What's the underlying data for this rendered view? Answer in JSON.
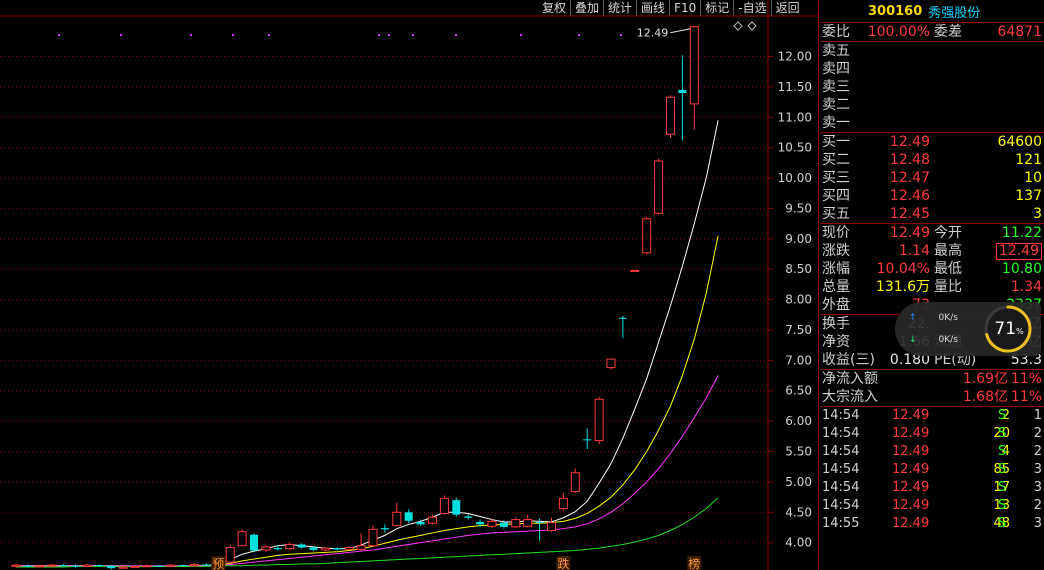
{
  "toolbar": {
    "buttons": [
      "复权",
      "叠加",
      "统计",
      "画线",
      "F10",
      "标记",
      "-自选",
      "返回"
    ]
  },
  "stock": {
    "code": "300160",
    "name": "秀强股份"
  },
  "chart_data": {
    "type": "candlestick",
    "price_ticks": [
      "12.00",
      "11.50",
      "11.00",
      "10.50",
      "10.00",
      "9.50",
      "9.00",
      "8.50",
      "8.00",
      "7.50",
      "7.00",
      "6.50",
      "6.00",
      "5.50",
      "5.00",
      "4.50",
      "4.00"
    ],
    "ylim": [
      3.55,
      12.65
    ],
    "high_label": "12.49",
    "markers": [
      "预",
      "跌",
      "榜"
    ],
    "candles": [
      {
        "o": 3.61,
        "c": 3.63,
        "h": 3.65,
        "l": 3.59
      },
      {
        "o": 3.62,
        "c": 3.61,
        "h": 3.64,
        "l": 3.59
      },
      {
        "o": 3.61,
        "c": 3.62,
        "h": 3.64,
        "l": 3.6
      },
      {
        "o": 3.62,
        "c": 3.63,
        "h": 3.65,
        "l": 3.6
      },
      {
        "o": 3.63,
        "c": 3.62,
        "h": 3.65,
        "l": 3.61
      },
      {
        "o": 3.62,
        "c": 3.61,
        "h": 3.64,
        "l": 3.59
      },
      {
        "o": 3.61,
        "c": 3.63,
        "h": 3.65,
        "l": 3.6
      },
      {
        "o": 3.63,
        "c": 3.62,
        "h": 3.64,
        "l": 3.6
      },
      {
        "o": 3.62,
        "c": 3.58,
        "h": 3.63,
        "l": 3.56
      },
      {
        "o": 3.58,
        "c": 3.6,
        "h": 3.62,
        "l": 3.57
      },
      {
        "o": 3.6,
        "c": 3.61,
        "h": 3.63,
        "l": 3.59
      },
      {
        "o": 3.61,
        "c": 3.62,
        "h": 3.64,
        "l": 3.6
      },
      {
        "o": 3.62,
        "c": 3.61,
        "h": 3.63,
        "l": 3.6
      },
      {
        "o": 3.61,
        "c": 3.63,
        "h": 3.65,
        "l": 3.6
      },
      {
        "o": 3.63,
        "c": 3.62,
        "h": 3.64,
        "l": 3.61
      },
      {
        "o": 3.62,
        "c": 3.64,
        "h": 3.66,
        "l": 3.61
      },
      {
        "o": 3.64,
        "c": 3.63,
        "h": 3.66,
        "l": 3.62
      },
      {
        "o": 3.63,
        "c": 3.67,
        "h": 3.7,
        "l": 3.62
      },
      {
        "o": 3.68,
        "c": 3.92,
        "h": 3.96,
        "l": 3.67
      },
      {
        "o": 3.95,
        "c": 4.18,
        "h": 4.22,
        "l": 3.94
      },
      {
        "o": 4.13,
        "c": 3.87,
        "h": 4.15,
        "l": 3.84
      },
      {
        "o": 3.88,
        "c": 3.93,
        "h": 3.96,
        "l": 3.85
      },
      {
        "o": 3.91,
        "c": 3.89,
        "h": 3.95,
        "l": 3.87
      },
      {
        "o": 3.9,
        "c": 3.97,
        "h": 4.0,
        "l": 3.88
      },
      {
        "o": 3.97,
        "c": 3.92,
        "h": 3.99,
        "l": 3.9
      },
      {
        "o": 3.92,
        "c": 3.88,
        "h": 3.94,
        "l": 3.86
      },
      {
        "o": 3.88,
        "c": 3.91,
        "h": 3.93,
        "l": 3.86
      },
      {
        "o": 3.91,
        "c": 3.89,
        "h": 3.92,
        "l": 3.87
      },
      {
        "o": 3.89,
        "c": 3.92,
        "h": 3.94,
        "l": 3.88
      },
      {
        "o": 3.89,
        "c": 3.95,
        "h": 4.15,
        "l": 3.87
      },
      {
        "o": 3.95,
        "c": 4.22,
        "h": 4.28,
        "l": 3.93
      },
      {
        "o": 4.24,
        "c": 4.22,
        "h": 4.3,
        "l": 4.16
      },
      {
        "o": 4.28,
        "c": 4.5,
        "h": 4.66,
        "l": 4.27
      },
      {
        "o": 4.5,
        "c": 4.36,
        "h": 4.55,
        "l": 4.32
      },
      {
        "o": 4.34,
        "c": 4.3,
        "h": 4.38,
        "l": 4.28
      },
      {
        "o": 4.32,
        "c": 4.42,
        "h": 4.46,
        "l": 4.3
      },
      {
        "o": 4.48,
        "c": 4.73,
        "h": 4.78,
        "l": 4.46
      },
      {
        "o": 4.7,
        "c": 4.46,
        "h": 4.74,
        "l": 4.43
      },
      {
        "o": 4.43,
        "c": 4.41,
        "h": 4.47,
        "l": 4.38
      },
      {
        "o": 4.34,
        "c": 4.3,
        "h": 4.38,
        "l": 4.26
      },
      {
        "o": 4.27,
        "c": 4.35,
        "h": 4.4,
        "l": 4.24
      },
      {
        "o": 4.33,
        "c": 4.26,
        "h": 4.36,
        "l": 4.23
      },
      {
        "o": 4.26,
        "c": 4.38,
        "h": 4.42,
        "l": 4.24
      },
      {
        "o": 4.27,
        "c": 4.38,
        "h": 4.46,
        "l": 4.25
      },
      {
        "o": 4.34,
        "c": 4.33,
        "h": 4.4,
        "l": 4.03
      },
      {
        "o": 4.2,
        "c": 4.33,
        "h": 4.41,
        "l": 4.18
      },
      {
        "o": 4.56,
        "c": 4.73,
        "h": 4.82,
        "l": 4.52
      },
      {
        "o": 4.84,
        "c": 5.15,
        "h": 5.22,
        "l": 4.82
      },
      {
        "o": 5.7,
        "c": 5.69,
        "h": 5.88,
        "l": 5.54
      },
      {
        "o": 5.68,
        "c": 6.36,
        "h": 6.4,
        "l": 5.62
      },
      {
        "o": 6.88,
        "c": 7.02,
        "h": 7.03,
        "l": 6.85
      },
      {
        "o": 7.7,
        "c": 7.69,
        "h": 7.73,
        "l": 7.37
      },
      {
        "o": 8.47,
        "c": 8.48,
        "h": 8.49,
        "l": 8.46
      },
      {
        "o": 8.77,
        "c": 9.33,
        "h": 9.36,
        "l": 8.74
      },
      {
        "o": 9.42,
        "c": 10.28,
        "h": 10.32,
        "l": 9.4
      },
      {
        "o": 10.72,
        "c": 11.33,
        "h": 11.36,
        "l": 10.66
      },
      {
        "o": 11.45,
        "c": 11.4,
        "h": 12.02,
        "l": 10.62
      },
      {
        "o": 11.22,
        "c": 12.49,
        "h": 12.49,
        "l": 10.8
      }
    ],
    "ma": [
      {
        "color": "#ffffff",
        "values": [
          3.62,
          3.62,
          3.62,
          3.62,
          3.62,
          3.62,
          3.62,
          3.62,
          3.61,
          3.61,
          3.61,
          3.61,
          3.61,
          3.61,
          3.62,
          3.62,
          3.63,
          3.64,
          3.72,
          3.81,
          3.86,
          3.9,
          3.95,
          3.97,
          3.95,
          3.93,
          3.91,
          3.9,
          3.9,
          3.96,
          4.04,
          4.12,
          4.23,
          4.3,
          4.35,
          4.42,
          4.5,
          4.5,
          4.48,
          4.43,
          4.38,
          4.34,
          4.34,
          4.36,
          4.35,
          4.34,
          4.41,
          4.51,
          4.68,
          4.98,
          5.3,
          5.72,
          6.2,
          6.7,
          7.3,
          7.9,
          8.55,
          9.25,
          10.0,
          10.95
        ]
      },
      {
        "color": "#ffff00",
        "values": [
          3.62,
          3.62,
          3.62,
          3.62,
          3.62,
          3.62,
          3.62,
          3.62,
          3.62,
          3.62,
          3.61,
          3.61,
          3.61,
          3.61,
          3.61,
          3.62,
          3.62,
          3.63,
          3.66,
          3.7,
          3.73,
          3.76,
          3.79,
          3.81,
          3.82,
          3.83,
          3.84,
          3.85,
          3.87,
          3.9,
          3.94,
          3.99,
          4.04,
          4.08,
          4.12,
          4.16,
          4.2,
          4.23,
          4.26,
          4.28,
          4.29,
          4.3,
          4.31,
          4.32,
          4.32,
          4.33,
          4.35,
          4.4,
          4.48,
          4.6,
          4.75,
          4.95,
          5.2,
          5.5,
          5.85,
          6.25,
          6.75,
          7.35,
          8.1,
          9.05
        ]
      },
      {
        "color": "#ff33ff",
        "values": [
          3.62,
          3.62,
          3.62,
          3.62,
          3.62,
          3.62,
          3.62,
          3.62,
          3.62,
          3.62,
          3.62,
          3.62,
          3.62,
          3.62,
          3.62,
          3.62,
          3.62,
          3.62,
          3.64,
          3.66,
          3.68,
          3.7,
          3.72,
          3.74,
          3.76,
          3.78,
          3.8,
          3.82,
          3.84,
          3.86,
          3.88,
          3.91,
          3.94,
          3.97,
          4.0,
          4.03,
          4.06,
          4.09,
          4.12,
          4.14,
          4.16,
          4.17,
          4.18,
          4.19,
          4.2,
          4.21,
          4.23,
          4.26,
          4.31,
          4.39,
          4.5,
          4.64,
          4.81,
          5.0,
          5.22,
          5.47,
          5.75,
          6.06,
          6.38,
          6.75
        ]
      },
      {
        "color": "#22dd22",
        "values": [
          3.6,
          3.6,
          3.6,
          3.6,
          3.6,
          3.61,
          3.61,
          3.61,
          3.61,
          3.61,
          3.61,
          3.61,
          3.61,
          3.61,
          3.61,
          3.61,
          3.61,
          3.62,
          3.62,
          3.62,
          3.63,
          3.63,
          3.64,
          3.64,
          3.65,
          3.65,
          3.66,
          3.67,
          3.68,
          3.69,
          3.7,
          3.71,
          3.72,
          3.73,
          3.74,
          3.75,
          3.76,
          3.77,
          3.78,
          3.79,
          3.8,
          3.81,
          3.82,
          3.83,
          3.84,
          3.85,
          3.86,
          3.87,
          3.89,
          3.91,
          3.94,
          3.97,
          4.01,
          4.06,
          4.12,
          4.2,
          4.3,
          4.42,
          4.56,
          4.74
        ]
      }
    ]
  },
  "quote": {
    "weibi_label": "委比",
    "weibi": "100.00%",
    "weicha_label": "委差",
    "weicha": "64871",
    "sell": [
      {
        "label": "卖五",
        "price": "",
        "vol": ""
      },
      {
        "label": "卖四",
        "price": "",
        "vol": ""
      },
      {
        "label": "卖三",
        "price": "",
        "vol": ""
      },
      {
        "label": "卖二",
        "price": "",
        "vol": ""
      },
      {
        "label": "卖一",
        "price": "",
        "vol": ""
      }
    ],
    "buy": [
      {
        "label": "买一",
        "price": "12.49",
        "vol": "64600"
      },
      {
        "label": "买二",
        "price": "12.48",
        "vol": "121"
      },
      {
        "label": "买三",
        "price": "12.47",
        "vol": "10"
      },
      {
        "label": "买四",
        "price": "12.46",
        "vol": "137"
      },
      {
        "label": "买五",
        "price": "12.45",
        "vol": "3"
      }
    ],
    "stats": [
      {
        "l1": "现价",
        "v1": "12.49",
        "c1": "red",
        "l2": "今开",
        "v2": "11.22",
        "c2": "green"
      },
      {
        "l1": "涨跌",
        "v1": "1.14",
        "c1": "red",
        "l2": "最高",
        "v2": "12.49",
        "c2": "red",
        "boxed": true
      },
      {
        "l1": "涨幅",
        "v1": "10.04%",
        "c1": "red",
        "l2": "最低",
        "v2": "10.80",
        "c2": "green"
      },
      {
        "l1": "总量",
        "v1": "131.6万",
        "c1": "yellow",
        "l2": "量比",
        "v2": "1.34",
        "c2": "red"
      },
      {
        "l1": "外盘",
        "v1": "73",
        "c1": "red",
        "l2": "",
        "v2": "2337",
        "c2": "green"
      }
    ],
    "stats2": [
      {
        "l1": "换手",
        "v1": "22.",
        "c1": "white",
        "l2": "",
        "v2": "19亿",
        "c2": "white"
      },
      {
        "l1": "净资",
        "v1": "1.66",
        "c1": "white",
        "l2": "流通",
        "v2": "5.81亿",
        "c2": "white"
      },
      {
        "l1": "收益(三)",
        "v1": "0.180",
        "c1": "white",
        "l2": "PE(动)",
        "v2": "53.3",
        "c2": "white"
      }
    ],
    "flows": [
      {
        "label": "净流入额",
        "value": "1.69亿",
        "pct": "11%"
      },
      {
        "label": "大宗流入",
        "value": "1.68亿",
        "pct": "11%"
      }
    ]
  },
  "trades": [
    {
      "time": "14:54",
      "price": "12.49",
      "vol": "2",
      "dir": "S",
      "count": "1"
    },
    {
      "time": "14:54",
      "price": "12.49",
      "vol": "20",
      "dir": "S",
      "count": "2"
    },
    {
      "time": "14:54",
      "price": "12.49",
      "vol": "4",
      "dir": "S",
      "count": "2"
    },
    {
      "time": "14:54",
      "price": "12.49",
      "vol": "85",
      "dir": "S",
      "count": "3"
    },
    {
      "time": "14:54",
      "price": "12.49",
      "vol": "17",
      "dir": "S",
      "count": "3"
    },
    {
      "time": "14:54",
      "price": "12.49",
      "vol": "13",
      "dir": "S",
      "count": "2"
    },
    {
      "time": "14:55",
      "price": "12.49",
      "vol": "48",
      "dir": "S",
      "count": "3"
    }
  ],
  "speed_widget": {
    "up": "0K/s",
    "down": "0K/s",
    "percent": "71",
    "unit": "%"
  },
  "colors": {
    "up": "#ff3b3b",
    "down": "#00e0e0",
    "grid": "#8b0000",
    "bg": "#000000"
  }
}
